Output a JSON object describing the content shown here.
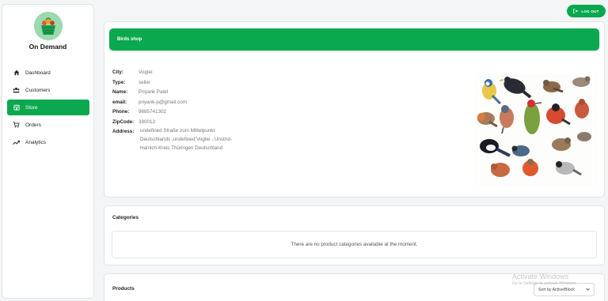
{
  "brand": {
    "title": "On Demand"
  },
  "sidebar": {
    "items": [
      {
        "label": "Dashboard",
        "icon": "home-icon"
      },
      {
        "label": "Customers",
        "icon": "users-icon"
      },
      {
        "label": "Store",
        "icon": "store-icon",
        "active": true
      },
      {
        "label": "Orders",
        "icon": "cart-icon"
      },
      {
        "label": "Analytics",
        "icon": "trend-icon"
      }
    ]
  },
  "topbar": {
    "logout_label": "LOG OUT"
  },
  "shop": {
    "name": "Birds shop",
    "city_label": "City:",
    "city": "Vogtei",
    "type_label": "Type:",
    "type": "seller",
    "name_label": "Name:",
    "owner": "Priyank Patel",
    "email_label": "email:",
    "email": "priyank-p@gmail.com",
    "phone_label": "Phone:",
    "phone": "9685741302",
    "zip_label": "ZipCode:",
    "zip": "380013",
    "address_label": "Address:",
    "address_line1": "undefined Straße zum Mittelpunkt",
    "address_line2": "Deutschlands ,undefined Vogtei , Unstrut-",
    "address_line3": "Hainich-Kreis Thüringen Deutschland"
  },
  "categories": {
    "title": "Categories",
    "empty_message": "There are no product categories available at the moment."
  },
  "products": {
    "title": "Products",
    "sort_value": "Sort by Active/Block"
  },
  "watermark": {
    "title": "Activate Windows",
    "subtitle": "Go to Settings to activate Windows."
  },
  "colors": {
    "accent": "#0aa84f",
    "background": "#f4f5f7"
  }
}
